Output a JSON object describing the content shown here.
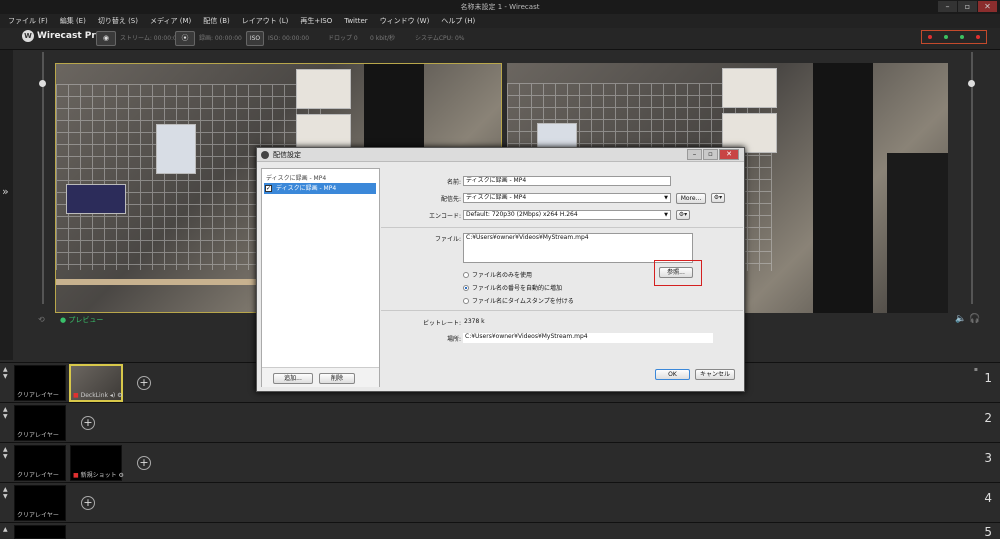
{
  "window": {
    "title": "名称未設定 1 - Wirecast",
    "controls": [
      "–",
      "▫",
      "✕"
    ]
  },
  "menu": [
    "ファイル (F)",
    "編集 (E)",
    "切り替え (S)",
    "メディア (M)",
    "配信 (B)",
    "レイアウト (L)",
    "再生+ISO",
    "Twitter",
    "ウィンドウ (W)",
    "ヘルプ (H)"
  ],
  "toolbar": {
    "logo_text": "Wirecast Pro",
    "stream_label": "ストリーム: 00:00:00",
    "record_label": "録画: 00:00:00",
    "iso_badge": "ISO",
    "iso_label": "ISO: 00:00:00",
    "dropped_label": "ドロップ 0",
    "bitrate_label": "0 kbit/秒",
    "cpu_label": "システムCPU: 0%",
    "status_colors": [
      "#e03030",
      "#3cc060",
      "#3cc060",
      "#e03030"
    ]
  },
  "preview": {
    "label": "プレビュー"
  },
  "layers": [
    {
      "label": "クリアレイヤー",
      "shots": [
        {
          "label": "DeckLink",
          "selected": true
        }
      ],
      "number": "1"
    },
    {
      "label": "クリアレイヤー",
      "shots": [],
      "number": "2"
    },
    {
      "label": "クリアレイヤー",
      "shots": [
        {
          "label": "新規ショット",
          "selected": false
        }
      ],
      "number": "3"
    },
    {
      "label": "クリアレイヤー",
      "shots": [],
      "number": "4"
    },
    {
      "label": "",
      "shots": [],
      "number": "5"
    }
  ],
  "dialog": {
    "title": "配信設定",
    "list_header": "ディスクに録画 - MP4",
    "list_item": "ディスクに録画 - MP4",
    "add_button": "追加...",
    "delete_button": "削除",
    "name_label": "名前:",
    "name_value": "ディスクに録画 - MP4",
    "destination_label": "配信先:",
    "destination_value": "ディスクに録画 - MP4",
    "more_button": "More...",
    "encoder_label": "エンコード:",
    "encoder_value": "Default: 720p30 (2Mbps) x264 H.264",
    "file_label": "ファイル:",
    "file_value": "C:¥Users¥owner¥Videos¥MyStream.mp4",
    "browse_button": "参照...",
    "radio_options": [
      {
        "label": "ファイル名のみを使用",
        "selected": false
      },
      {
        "label": "ファイル名の番号を自動的に増加",
        "selected": true
      },
      {
        "label": "ファイル名にタイムスタンプを付ける",
        "selected": false
      }
    ],
    "bitrate_label": "ビットレート:",
    "bitrate_value": "2378 k",
    "location_label": "場所:",
    "location_value": "C:¥Users¥owner¥Videos¥MyStream.mp4",
    "ok_button": "OK",
    "cancel_button": "キャンセル"
  }
}
